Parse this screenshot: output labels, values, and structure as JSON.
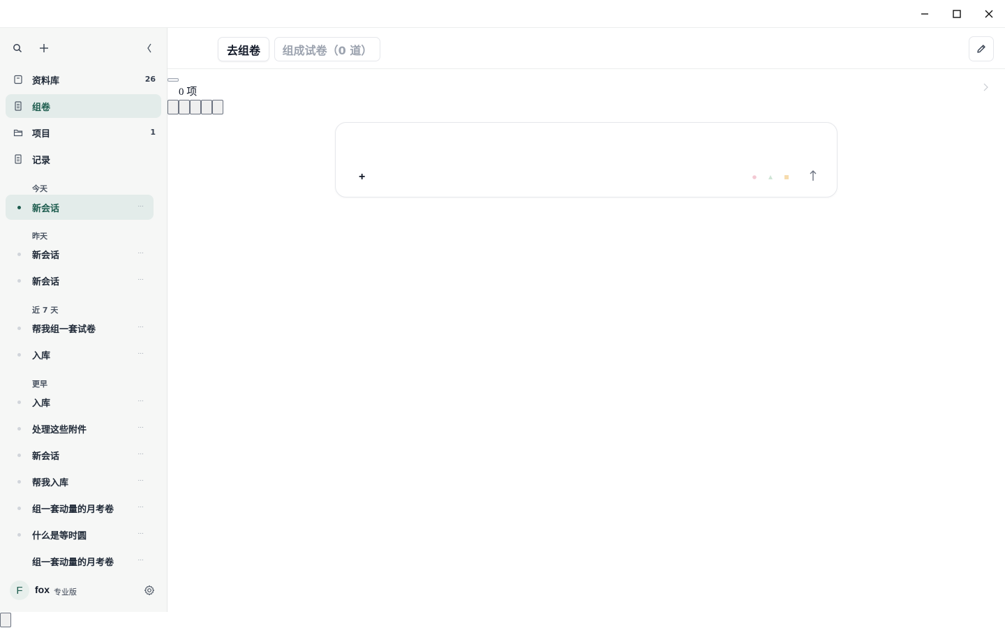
{
  "window": {
    "controls": [
      "minimize-icon",
      "maximize-icon",
      "close-icon"
    ]
  },
  "sidebar": {
    "top_icons": [
      "search-icon",
      "plus-icon",
      "collapse-sidebar-icon"
    ],
    "nav": [
      {
        "label": "资料库",
        "count": "26",
        "icon": "library-icon",
        "active": false
      },
      {
        "label": "组卷",
        "count": "",
        "icon": "document-icon",
        "active": true
      },
      {
        "label": "项目",
        "count": "1",
        "icon": "folder-icon",
        "active": false
      },
      {
        "label": "记录",
        "count": "",
        "icon": "document-icon",
        "active": false
      }
    ],
    "groups": {
      "today": "今天",
      "yesterday": "昨天",
      "last7": "近 7 天",
      "earlier": "更早"
    },
    "chats": {
      "today": [
        "新会话"
      ],
      "yesterday": [
        "新会话",
        "新会话"
      ],
      "last7": [
        "帮我组一套试卷",
        "入库"
      ],
      "earlier": [
        "入库",
        "处理这些附件",
        "新会话",
        "帮我入库",
        "组一套动量的月考卷",
        "什么是等时圆",
        "组一套动量的月考卷"
      ]
    },
    "more_label": "...",
    "user": {
      "avatar_letter": "F",
      "name": "fox",
      "plan": "专业版"
    }
  },
  "main": {
    "tabs": {
      "primary": "去组卷",
      "secondary": "组成试卷（0 道）"
    },
    "count_text": "0 项",
    "composer": {
      "plus": "+",
      "indicator_colors": [
        "#f3c9d3",
        "#cfe5d6",
        "#f6dcae"
      ]
    }
  },
  "colors": {
    "accent": "#1d5c4e",
    "active_bg": "#e3ecea",
    "sidebar_bg": "#f6f7f6"
  }
}
